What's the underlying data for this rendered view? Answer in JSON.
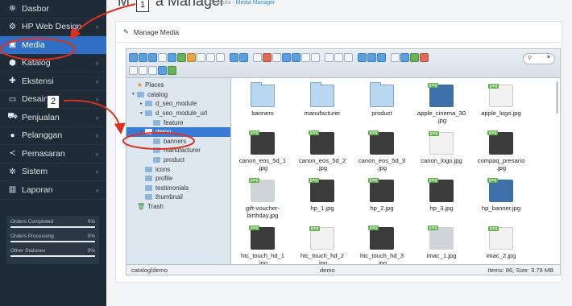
{
  "sidebar": {
    "items": [
      {
        "label": "Dasbor",
        "icon": "dashboard-icon",
        "glyph": "⊛",
        "chevron": false,
        "active": false
      },
      {
        "label": "HP Web Design",
        "icon": "cogs-icon",
        "glyph": "⚙",
        "chevron": true,
        "active": false
      },
      {
        "label": "Media",
        "icon": "image-icon",
        "glyph": "▣",
        "chevron": false,
        "active": true
      },
      {
        "label": "Katalog",
        "icon": "tag-icon",
        "glyph": "⬢",
        "chevron": true,
        "active": false
      },
      {
        "label": "Ekstensi",
        "icon": "puzzle-icon",
        "glyph": "✚",
        "chevron": true,
        "active": false
      },
      {
        "label": "Desain",
        "icon": "monitor-icon",
        "glyph": "▭",
        "chevron": true,
        "active": false
      },
      {
        "label": "Penjualan",
        "icon": "cart-icon",
        "glyph": "⛟",
        "chevron": true,
        "active": false
      },
      {
        "label": "Pelanggan",
        "icon": "user-icon",
        "glyph": "●",
        "chevron": true,
        "active": false
      },
      {
        "label": "Pemasaran",
        "icon": "share-icon",
        "glyph": "≺",
        "chevron": true,
        "active": false
      },
      {
        "label": "Sistem",
        "icon": "gear-icon",
        "glyph": "✲",
        "chevron": true,
        "active": false
      },
      {
        "label": "Laporan",
        "icon": "bar-chart-icon",
        "glyph": "▥",
        "chevron": true,
        "active": false
      }
    ],
    "stats": [
      {
        "label": "Orders Completed",
        "pct": "0%",
        "value": 0
      },
      {
        "label": "Orders Processing",
        "pct": "0%",
        "value": 0
      },
      {
        "label": "Other Statuses",
        "pct": "0%",
        "value": 0
      }
    ]
  },
  "header": {
    "title_left": "M",
    "title_right": "a Manager",
    "breadcrumb_home": "Beranda",
    "breadcrumb_sep": "›",
    "breadcrumb_current": "Media Manager"
  },
  "panel": {
    "title": "Manage Media"
  },
  "finder": {
    "search_placeholder": "",
    "tree": [
      {
        "label": "Places",
        "indent": 0,
        "type": "places"
      },
      {
        "label": "catalog",
        "indent": 0,
        "type": "folder",
        "arrow": "▼"
      },
      {
        "label": "d_seo_module",
        "indent": 1,
        "type": "folder",
        "arrow": "►"
      },
      {
        "label": "d_seo_module_url",
        "indent": 1,
        "type": "folder",
        "arrow": "▼"
      },
      {
        "label": "feature",
        "indent": 2,
        "type": "folder",
        "arrow": ""
      },
      {
        "label": "demo",
        "indent": 1,
        "type": "folder",
        "arrow": "▼",
        "selected": true
      },
      {
        "label": "banners",
        "indent": 2,
        "type": "folder",
        "arrow": ""
      },
      {
        "label": "manufacturer",
        "indent": 2,
        "type": "folder",
        "arrow": ""
      },
      {
        "label": "product",
        "indent": 2,
        "type": "folder",
        "arrow": ""
      },
      {
        "label": "icons",
        "indent": 1,
        "type": "folder",
        "arrow": ""
      },
      {
        "label": "profile",
        "indent": 1,
        "type": "folder",
        "arrow": ""
      },
      {
        "label": "testimonials",
        "indent": 1,
        "type": "folder",
        "arrow": ""
      },
      {
        "label": "thumbnail",
        "indent": 1,
        "type": "folder",
        "arrow": ""
      },
      {
        "label": "Trash",
        "indent": 0,
        "type": "trash",
        "arrow": ""
      }
    ],
    "files": [
      {
        "name": "banners",
        "kind": "folder"
      },
      {
        "name": "manufacturer",
        "kind": "folder"
      },
      {
        "name": "product",
        "kind": "folder"
      },
      {
        "name": "apple_cinema_30\n.jpg",
        "kind": "img",
        "tone": "blue"
      },
      {
        "name": "apple_logo.jpg",
        "kind": "img",
        "tone": "white"
      },
      {
        "name": "canon_eos_5d_1\n.jpg",
        "kind": "img",
        "tone": "dark"
      },
      {
        "name": "canon_eos_5d_2\n.jpg",
        "kind": "img",
        "tone": "dark"
      },
      {
        "name": "canon_eos_5d_3\n.jpg",
        "kind": "img",
        "tone": "dark"
      },
      {
        "name": "canon_logo.jpg",
        "kind": "img",
        "tone": "white"
      },
      {
        "name": "compaq_presario\n.jpg",
        "kind": "img",
        "tone": "dark"
      },
      {
        "name": "gift-voucher-\nbirthday.jpg",
        "kind": "img",
        "tone": "light"
      },
      {
        "name": "hp_1.jpg",
        "kind": "img",
        "tone": "dark"
      },
      {
        "name": "hp_2.jpg",
        "kind": "img",
        "tone": "dark"
      },
      {
        "name": "hp_3.jpg",
        "kind": "img",
        "tone": "dark"
      },
      {
        "name": "hp_banner.jpg",
        "kind": "img",
        "tone": "blue"
      },
      {
        "name": "htc_touch_hd_1\n.jpg",
        "kind": "img",
        "tone": "dark"
      },
      {
        "name": "htc_touch_hd_2\n.jpg",
        "kind": "img",
        "tone": "white"
      },
      {
        "name": "htc_touch_hd_3\n.jpg",
        "kind": "img",
        "tone": "dark"
      },
      {
        "name": "imac_1.jpg",
        "kind": "img",
        "tone": "light"
      },
      {
        "name": "imac_2.jpg",
        "kind": "img",
        "tone": "white"
      }
    ],
    "file_tag": "jpeg",
    "status_path": "catalog/demo",
    "status_folder": "demo",
    "status_items": "Items: 86, Size: 3.79 MB"
  },
  "annotations": {
    "callout1": "1",
    "callout2": "2",
    "color": "#e0301e"
  },
  "colors": {
    "sidebar_bg": "#1f2b36",
    "active_bg": "#2f6fc6",
    "selection": "#3a7bd5"
  }
}
